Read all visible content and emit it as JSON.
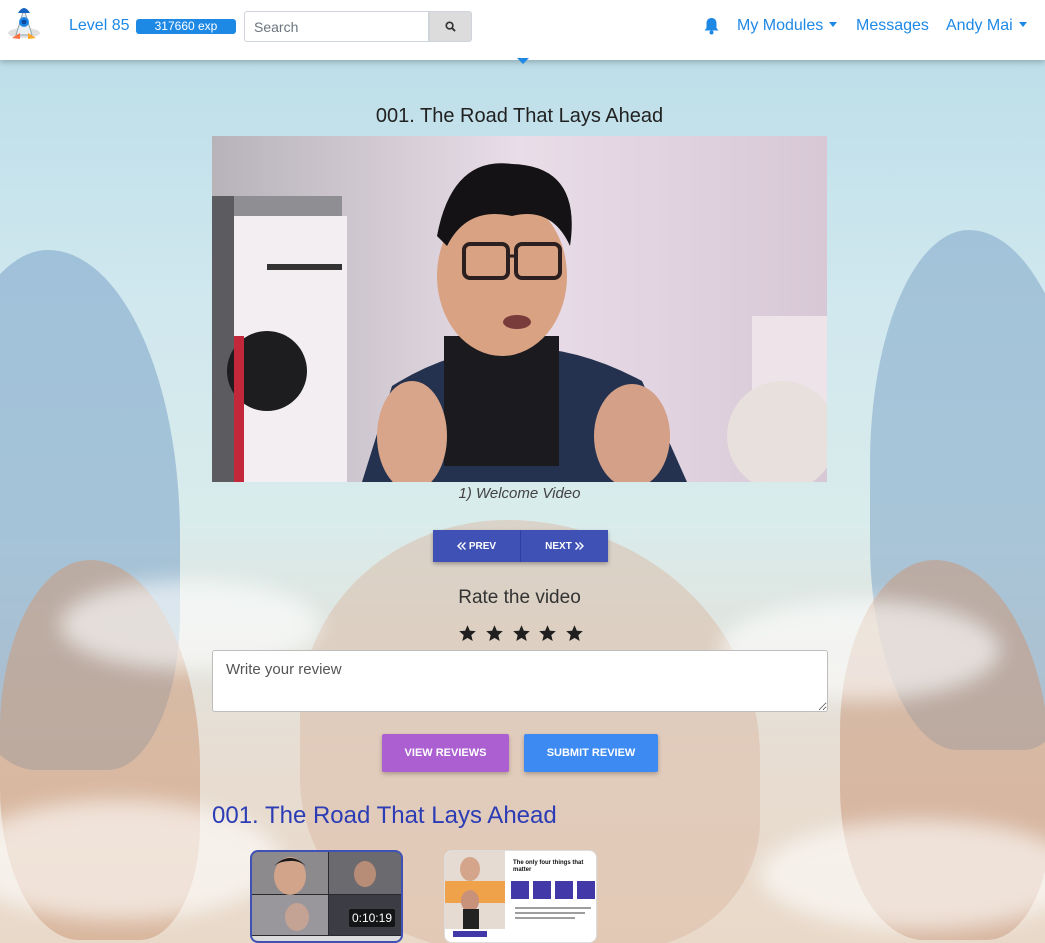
{
  "header": {
    "level_label": "Level 85",
    "exp_label": "317660 exp",
    "search_placeholder": "Search",
    "nav": {
      "my_modules": "My Modules",
      "messages": "Messages",
      "user_name": "Andy Mai"
    }
  },
  "video": {
    "title": "001. The Road That Lays Ahead",
    "caption": "1) Welcome Video"
  },
  "pager": {
    "prev_label": "PREV",
    "next_label": "NEXT"
  },
  "rating": {
    "title": "Rate the video",
    "stars_total": 5,
    "stars_selected": 5
  },
  "review": {
    "placeholder": "Write your review",
    "view_reviews_label": "VIEW REVIEWS",
    "submit_review_label": "SUBMIT REVIEW"
  },
  "playlist": {
    "title": "001. The Road That Lays Ahead",
    "items": [
      {
        "duration": "0:10:19",
        "selected": true
      },
      {
        "slide_heading": "The only four things that matter",
        "selected": false
      }
    ]
  },
  "colors": {
    "accent": "#1e88e5",
    "pager": "#3f51b5",
    "view_reviews": "#ab5fd1",
    "submit_review": "#3d8bf2",
    "section_title": "#2b3cb5"
  }
}
